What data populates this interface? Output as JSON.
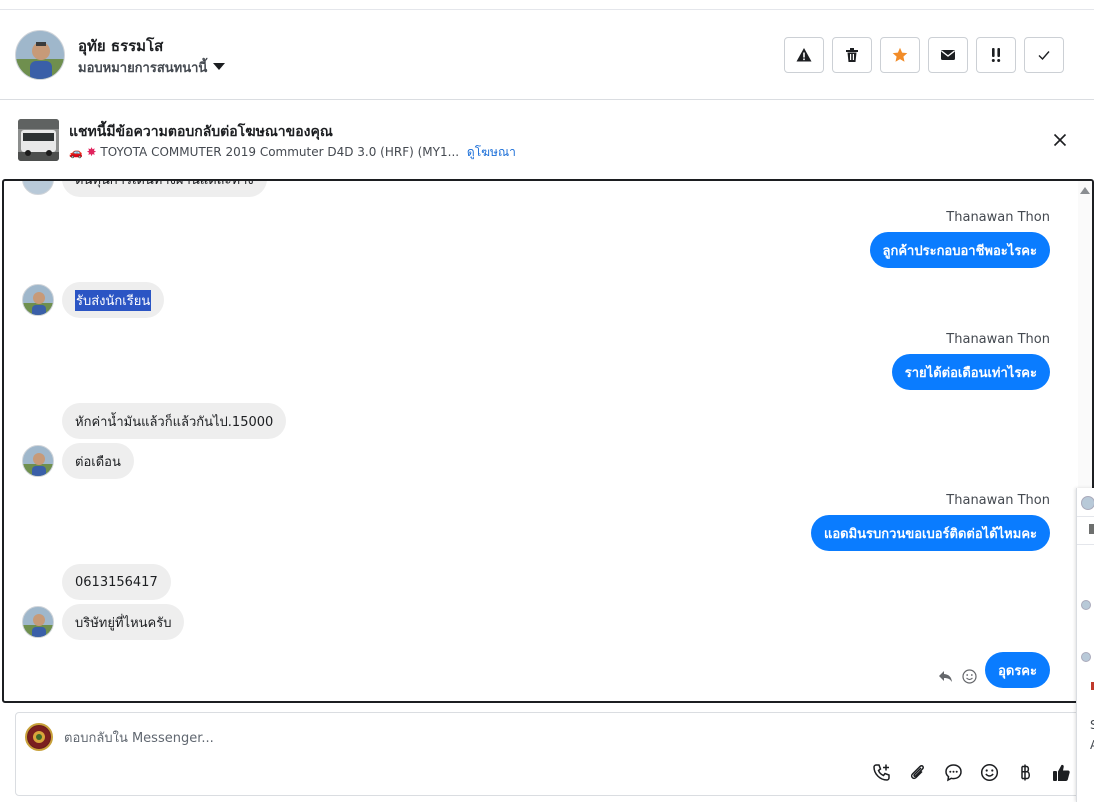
{
  "header": {
    "contact_name": "อุทัย ธรรมโส",
    "assign_label": "มอบหมายการสนทนานี้",
    "actions": [
      {
        "name": "spam-button",
        "icon": "warning-icon"
      },
      {
        "name": "delete-button",
        "icon": "trash-icon"
      },
      {
        "name": "star-button",
        "icon": "star-icon",
        "color": "#f28c28"
      },
      {
        "name": "mark-unread-button",
        "icon": "envelope-icon"
      },
      {
        "name": "follow-up-button",
        "icon": "double-exclamation-icon"
      },
      {
        "name": "mark-done-button",
        "icon": "checkmark-icon"
      }
    ]
  },
  "ad_banner": {
    "title": "แชทนี้มีข้อความตอบกลับต่อโฆษณาของคุณ",
    "subtitle": "TOYOTA COMMUTER 2019 Commuter D4D 3.0 (HRF) (MY1...",
    "view_ad": "ดูโฆษณา"
  },
  "conversation": {
    "partial_top_text": "ต้นทุนการเดินทางผ่านแต่ละทาง",
    "messages": [
      {
        "side": "out",
        "sender": "Thanawan Thon",
        "text": "ลูกค้าประกอบอาชีพอะไรคะ"
      },
      {
        "side": "in",
        "text": "รับส่งนักเรียน",
        "selected": true
      },
      {
        "side": "out",
        "sender": "Thanawan Thon",
        "text": "รายได้ต่อเดือนเท่าไรคะ"
      },
      {
        "side": "in",
        "text": "หักค่าน้ำมันแล้วก็แล้วกันไป.15000"
      },
      {
        "side": "in",
        "text": "ต่อเดือน"
      },
      {
        "side": "out",
        "sender": "Thanawan Thon",
        "text": "แอดมินรบกวนขอเบอร์ติดต่อได้ไหมคะ"
      },
      {
        "side": "in",
        "text": "0613156417"
      },
      {
        "side": "in",
        "text": "บริษัทยู่ที่ไหนครับ"
      },
      {
        "side": "out",
        "text": "อุดรคะ"
      }
    ]
  },
  "composer": {
    "placeholder": "ตอบกลับใน Messenger...",
    "tools": [
      "call-add-icon",
      "attachment-icon",
      "chat-bubble-icon",
      "emoji-icon",
      "baht-icon",
      "thumbs-up-icon"
    ]
  },
  "side_peek": {
    "letter_s": "S",
    "letter_a": "A"
  },
  "colors": {
    "outgoing_bubble": "#0a7cff",
    "incoming_bubble": "#eeeeee",
    "link": "#1a6ed8",
    "star": "#f28c28"
  }
}
